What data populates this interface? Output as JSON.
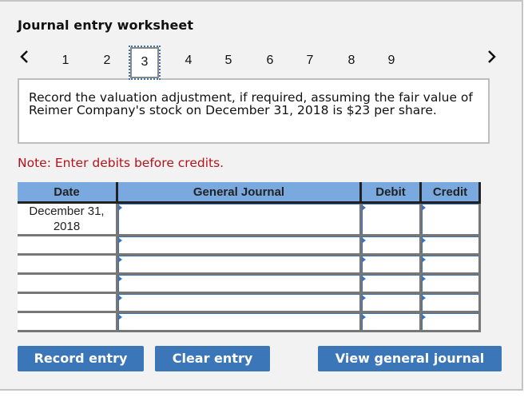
{
  "worksheet": {
    "title": "Journal entry worksheet",
    "tabs": {
      "prev_icon": "‹",
      "next_icon": "›",
      "items": [
        "1",
        "2",
        "3",
        "4",
        "5",
        "6",
        "7",
        "8",
        "9"
      ],
      "active": "3"
    },
    "prompt": "Record the valuation adjustment, if required, assuming the fair value of Reimer Company's stock on December 31, 2018 is $23 per share.",
    "note": "Note: Enter debits before credits."
  },
  "journal": {
    "headers": {
      "date": "Date",
      "general_journal": "General Journal",
      "debit": "Debit",
      "credit": "Credit"
    },
    "rows": [
      {
        "date": "December 31, 2018",
        "account": "",
        "debit": "",
        "credit": ""
      },
      {
        "date": "",
        "account": "",
        "debit": "",
        "credit": ""
      },
      {
        "date": "",
        "account": "",
        "debit": "",
        "credit": ""
      },
      {
        "date": "",
        "account": "",
        "debit": "",
        "credit": ""
      },
      {
        "date": "",
        "account": "",
        "debit": "",
        "credit": ""
      },
      {
        "date": "",
        "account": "",
        "debit": "",
        "credit": ""
      }
    ]
  },
  "buttons": {
    "record": "Record entry",
    "clear": "Clear entry",
    "view": "View general journal"
  },
  "colors": {
    "header_bg": "#7aa9e0",
    "button_bg": "#3b76b8",
    "note_text": "#b5121b",
    "input_border": "#3b6fb6"
  }
}
